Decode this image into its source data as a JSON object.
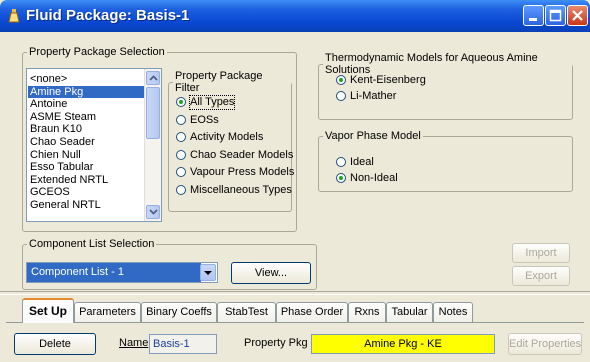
{
  "window": {
    "title": "Fluid Package: Basis-1"
  },
  "property_package_selection": {
    "legend": "Property Package Selection",
    "items": [
      "<none>",
      "Amine Pkg",
      "Antoine",
      "ASME Steam",
      "Braun K10",
      "Chao Seader",
      "Chien Null",
      "Esso Tabular",
      "Extended NRTL",
      "GCEOS",
      "General NRTL"
    ],
    "selected": "Amine Pkg"
  },
  "property_package_filter": {
    "legend": "Property Package Filter",
    "options": [
      "All Types",
      "EOSs",
      "Activity Models",
      "Chao Seader Models",
      "Vapour Press Models",
      "Miscellaneous Types"
    ],
    "selected": "All Types"
  },
  "thermo_models": {
    "legend": "Thermodynamic Models for Aqueous Amine Solutions",
    "options": [
      "Kent-Eisenberg",
      "Li-Mather"
    ],
    "selected": "Kent-Eisenberg"
  },
  "vapor_phase_model": {
    "legend": "Vapor Phase Model",
    "options": [
      "Ideal",
      "Non-Ideal"
    ],
    "selected": "Non-Ideal"
  },
  "component_list_selection": {
    "legend": "Component List Selection",
    "value": "Component List - 1",
    "view_button": "View..."
  },
  "side_buttons": {
    "import": "Import",
    "export": "Export"
  },
  "tabs": [
    "Set Up",
    "Parameters",
    "Binary Coeffs",
    "StabTest",
    "Phase Order",
    "Rxns",
    "Tabular",
    "Notes"
  ],
  "active_tab": "Set Up",
  "bottom": {
    "delete": "Delete",
    "name_label": "Name",
    "name_value": "Basis-1",
    "property_pkg_label": "Property Pkg",
    "property_pkg_value": "Amine Pkg - KE",
    "edit_properties": "Edit Properties"
  },
  "colors": {
    "titlebar": "#0a48d2",
    "selection": "#316ac5",
    "property_pkg_bg": "#ffff00",
    "radio_dot": "#21a121"
  }
}
